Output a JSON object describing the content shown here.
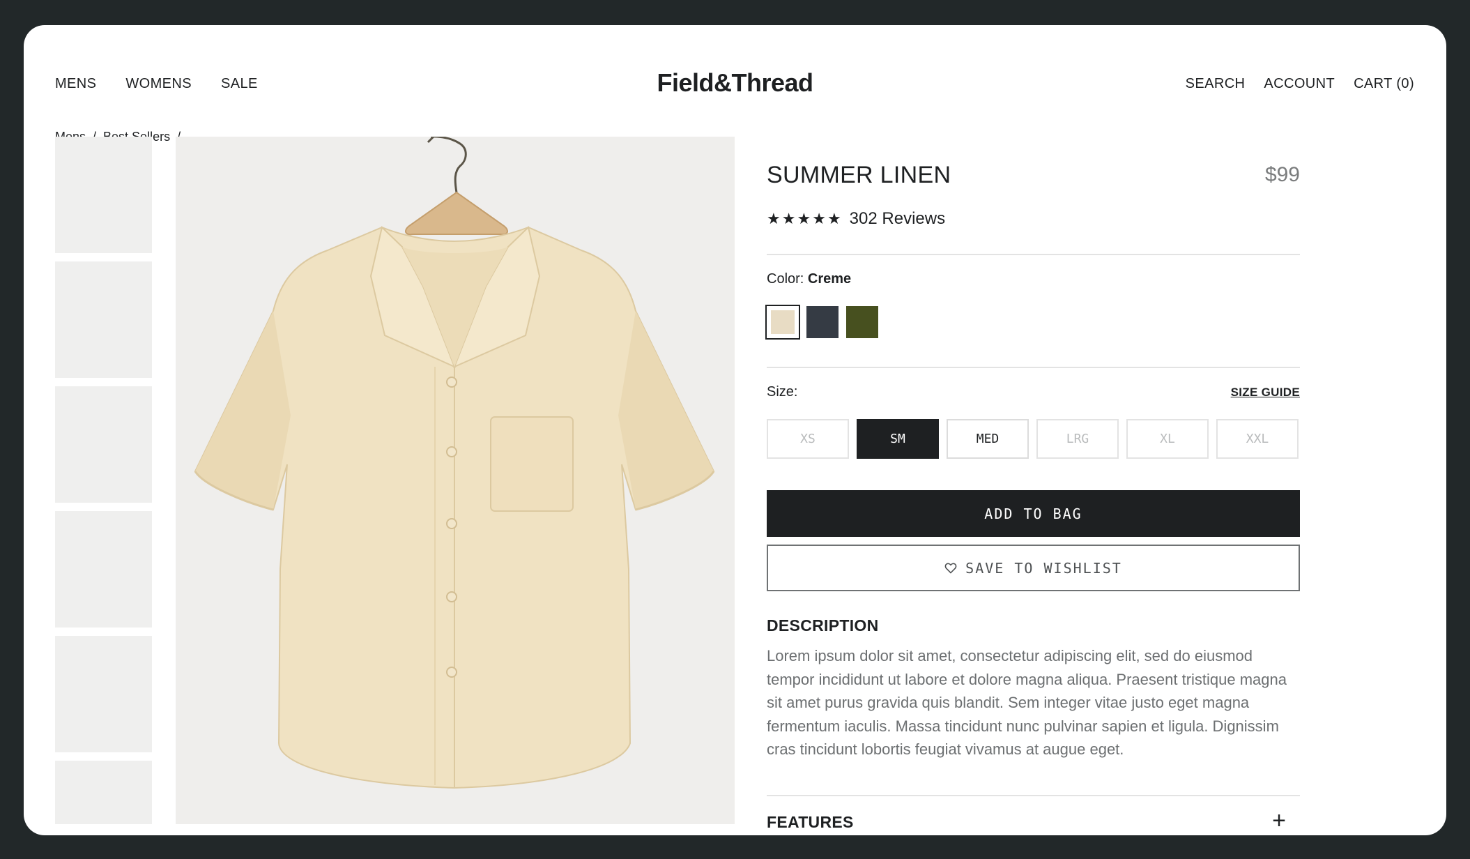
{
  "nav": {
    "left": [
      "MENS",
      "WOMENS",
      "SALE"
    ],
    "logo": "Field&Thread",
    "right": [
      "SEARCH",
      "ACCOUNT",
      "CART (0)"
    ]
  },
  "breadcrumb": {
    "items": [
      "Mens",
      "Best Sellers"
    ],
    "separator": "/"
  },
  "product": {
    "title": "SUMMER LINEN",
    "price": "$99",
    "rating_stars": 5,
    "reviews": "302 Reviews",
    "color_label": "Color:",
    "color_value": "Creme",
    "colors": [
      {
        "name": "creme",
        "hex": "#e8dcc4",
        "selected": true
      },
      {
        "name": "slate",
        "hex": "#353b44",
        "selected": false
      },
      {
        "name": "olive",
        "hex": "#47501f",
        "selected": false
      }
    ],
    "size_label": "Size:",
    "size_guide": "SIZE GUIDE",
    "sizes": [
      {
        "label": "XS",
        "state": "unavailable"
      },
      {
        "label": "SM",
        "state": "selected"
      },
      {
        "label": "MED",
        "state": "available"
      },
      {
        "label": "LRG",
        "state": "unavailable"
      },
      {
        "label": "XL",
        "state": "unavailable"
      },
      {
        "label": "XXL",
        "state": "unavailable"
      }
    ],
    "add_to_bag": "ADD TO BAG",
    "save_to_wishlist": "SAVE TO WISHLIST",
    "description_title": "DESCRIPTION",
    "description": "Lorem ipsum dolor sit amet, consectetur adipiscing elit, sed do eiusmod tempor incididunt ut labore et dolore magna aliqua. Praesent tristique magna sit amet purus gravida quis blandit. Sem integer vitae justo eget magna fermentum iaculis. Massa tincidunt nunc pulvinar sapien et ligula. Dignissim cras tincidunt lobortis feugiat vivamus at augue eget.",
    "features_title": "FEATURES"
  },
  "gallery": {
    "thumbnail_count": 6
  },
  "colors": {
    "dark": "#1e2022",
    "frame": "#222829",
    "placeholder": "#efefee",
    "muted_text": "#6c6f71",
    "price": "#7a7c7d"
  }
}
